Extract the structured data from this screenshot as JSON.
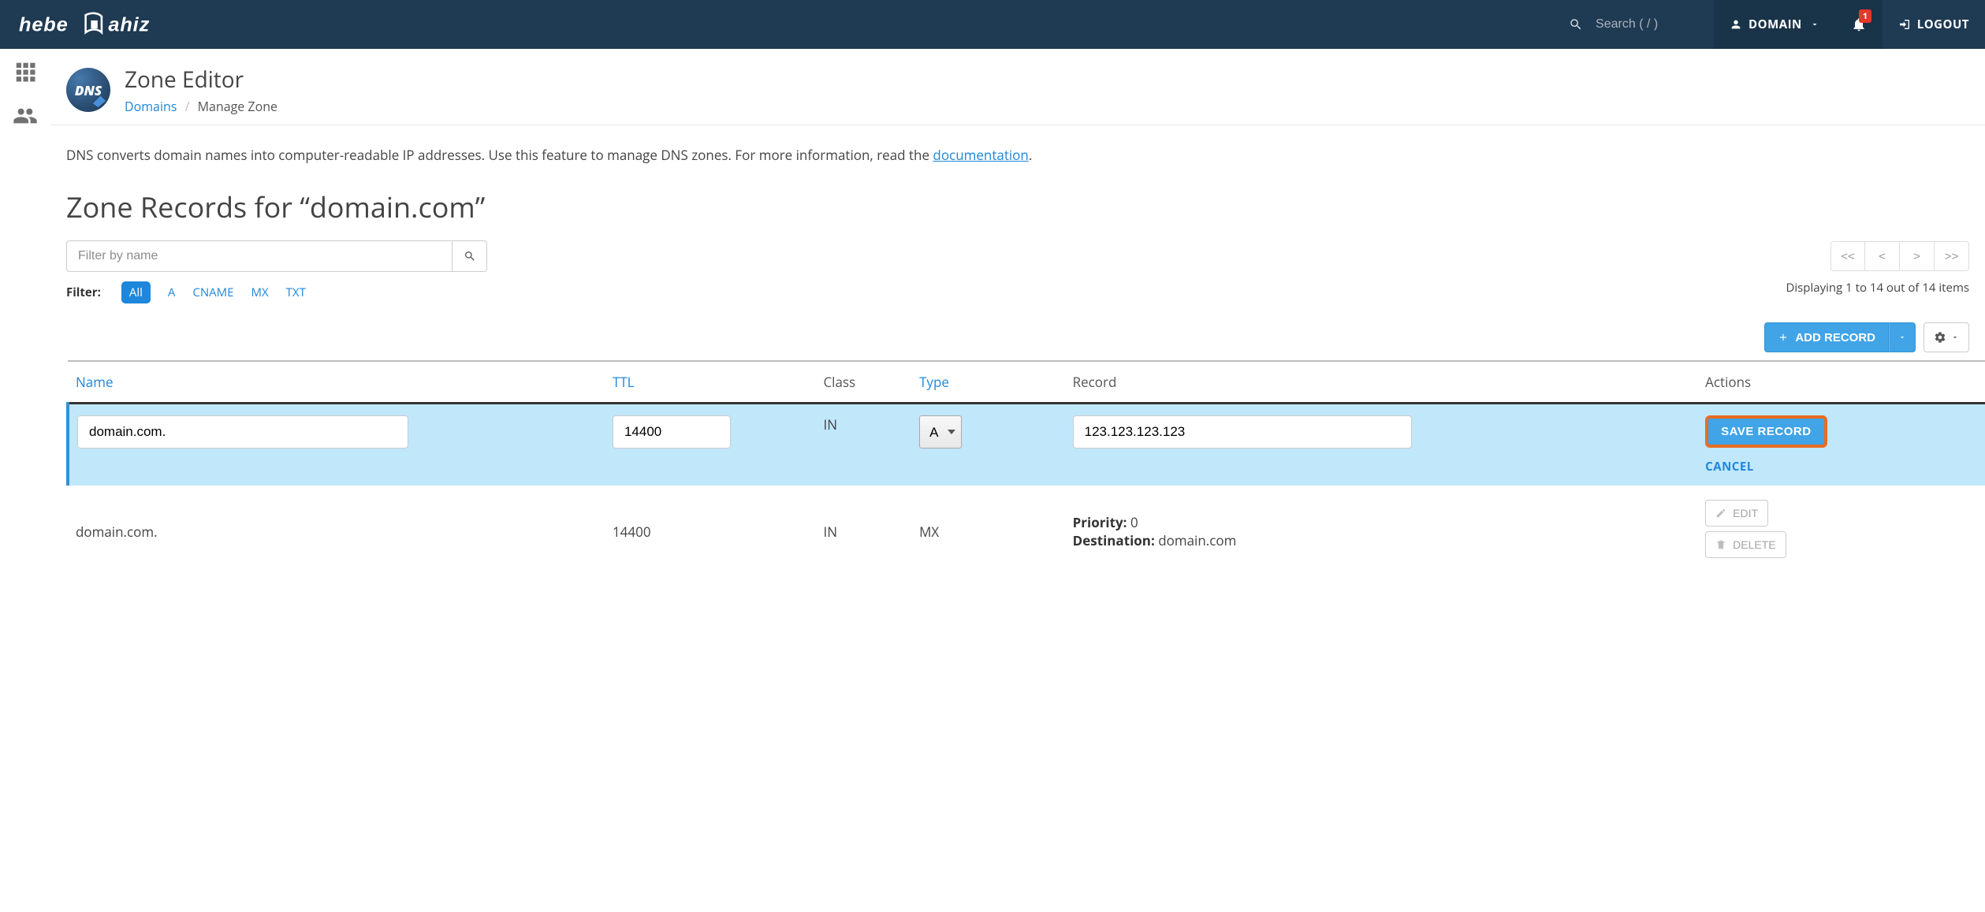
{
  "nav": {
    "logo_text": "hebeRGahiz",
    "search_placeholder": "Search ( / )",
    "domain_label": "DOMAIN",
    "notification_count": "1",
    "logout_label": "LOGOUT"
  },
  "page": {
    "dns_badge": "DNS",
    "title": "Zone Editor",
    "breadcrumb": {
      "domains": "Domains",
      "current": "Manage Zone"
    },
    "intro_pre": "DNS converts domain names into computer-readable IP addresses. Use this feature to manage DNS zones. For more information, read the ",
    "intro_link": "documentation",
    "intro_post": ".",
    "section_title": "Zone Records for “domain.com”"
  },
  "filter": {
    "placeholder": "Filter by name",
    "label": "Filter:",
    "options": [
      "All",
      "A",
      "CNAME",
      "MX",
      "TXT"
    ],
    "active_index": 0
  },
  "pager": {
    "first": "<<",
    "prev": "<",
    "next": ">",
    "last": ">>",
    "info": "Displaying 1 to 14 out of 14 items"
  },
  "actions": {
    "add_record": "ADD RECORD"
  },
  "table": {
    "headers": {
      "name": "Name",
      "ttl": "TTL",
      "class": "Class",
      "type": "Type",
      "record": "Record",
      "actions": "Actions"
    },
    "editing": {
      "name": "domain.com.",
      "ttl": "14400",
      "class": "IN",
      "type": "A",
      "record": "123.123.123.123",
      "save": "SAVE RECORD",
      "cancel": "CANCEL"
    },
    "rows": [
      {
        "name": "domain.com.",
        "ttl": "14400",
        "class": "IN",
        "type": "MX",
        "record": {
          "priority_label": "Priority:",
          "priority": "0",
          "dest_label": "Destination:",
          "dest": "domain.com"
        },
        "edit": "EDIT",
        "delete": "DELETE"
      }
    ]
  }
}
